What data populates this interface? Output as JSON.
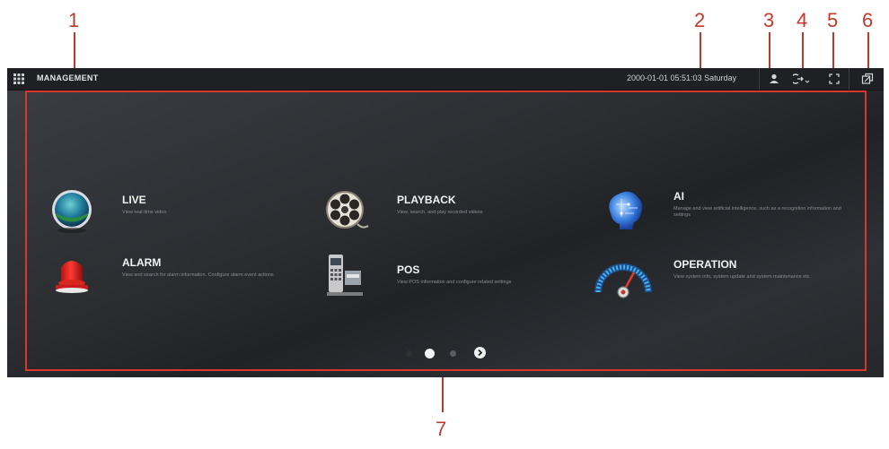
{
  "callouts": [
    "1",
    "2",
    "3",
    "4",
    "5",
    "6",
    "7"
  ],
  "topbar": {
    "title": "MANAGEMENT",
    "datetime": "2000-01-01 05:51:03 Saturday",
    "icons": {
      "grid": "grid-icon",
      "user": "user-icon",
      "logout": "logout-icon",
      "fullscreen": "fullscreen-icon",
      "switch": "switch-window-icon"
    }
  },
  "tiles": [
    {
      "title": "LIVE",
      "desc": "View real-time video",
      "icon": "live-globe-icon"
    },
    {
      "title": "PLAYBACK",
      "desc": "View, search, and play recorded videos",
      "icon": "film-reel-icon"
    },
    {
      "title": "AI",
      "desc": "Manage and view artificial intelligence, such as a recognition information and settings",
      "icon": "ai-brain-icon"
    },
    {
      "title": "ALARM",
      "desc": "View and search for alarm information. Configure alarm event actions",
      "icon": "alarm-siren-icon"
    },
    {
      "title": "POS",
      "desc": "View POS information and configure related settings",
      "icon": "pos-terminal-icon"
    },
    {
      "title": "OPERATION",
      "desc": "View system info, system update and system maintenance etc.",
      "icon": "gauge-icon"
    }
  ],
  "pagination": {
    "pages": 2,
    "current": 1
  },
  "colors": {
    "callout": "#c0392b",
    "frame": "#d9372d",
    "topbar": "#1f2023"
  }
}
